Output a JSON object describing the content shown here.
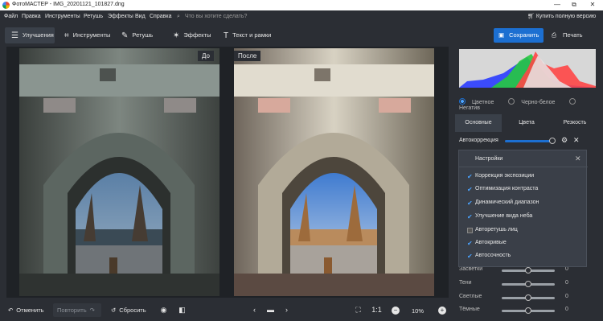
{
  "window": {
    "title": "ФотоМАСТЕР - IMG_20201121_101827.dng",
    "min": "—",
    "max": "⧉",
    "close": "✕"
  },
  "menu": [
    "Файл",
    "Правка",
    "Инструменты",
    "Ретушь",
    "Эффекты",
    "Вид",
    "Справка"
  ],
  "search": {
    "placeholder": "Что вы хотите сделать?",
    "icon": "search-icon"
  },
  "buy_label": "Купить полную версию",
  "tabs": [
    {
      "label": "Улучшения",
      "active": true
    },
    {
      "label": "Инструменты"
    },
    {
      "label": "Ретушь"
    },
    {
      "label": "Эффекты"
    },
    {
      "label": "Текст и рамки"
    }
  ],
  "save_label": "Сохранить",
  "print_label": "Печать",
  "before_label": "До",
  "after_label": "После",
  "color_modes": [
    {
      "label": "Цветное",
      "selected": true
    },
    {
      "label": "Черно-белое"
    },
    {
      "label": "Негатив"
    }
  ],
  "panel_tabs": [
    {
      "label": "Основные",
      "active": true
    },
    {
      "label": "Цвета"
    },
    {
      "label": "Резкость"
    }
  ],
  "autocorrect": {
    "label": "Автокоррекция",
    "value": 1.0
  },
  "settings": {
    "title": "Настройки",
    "options": [
      {
        "label": "Коррекция экспозиции",
        "checked": true
      },
      {
        "label": "Оптимизация контраста",
        "checked": true
      },
      {
        "label": "Динамический диапазон",
        "checked": true
      },
      {
        "label": "Улучшение вида неба",
        "checked": true
      },
      {
        "label": "Авторетушь лиц",
        "checked": false
      },
      {
        "label": "Автокривые",
        "checked": true
      },
      {
        "label": "Автосочность",
        "checked": true
      }
    ]
  },
  "sliders": [
    {
      "label": "Засветки",
      "value": "0",
      "level": 0.5
    },
    {
      "label": "Тени",
      "value": "0",
      "level": 0.5
    },
    {
      "label": "Светлые",
      "value": "0",
      "level": 0.5
    },
    {
      "label": "Тёмные",
      "value": "0",
      "level": 0.5
    }
  ],
  "bottom": {
    "undo": "Отменить",
    "redo": "Повторить",
    "reset": "Сбросить",
    "ratio": "1:1",
    "zoom": "10%"
  },
  "colors": {
    "accent": "#1c6fd1",
    "panel": "#2b2e34",
    "tab_active": "#3a4049"
  }
}
